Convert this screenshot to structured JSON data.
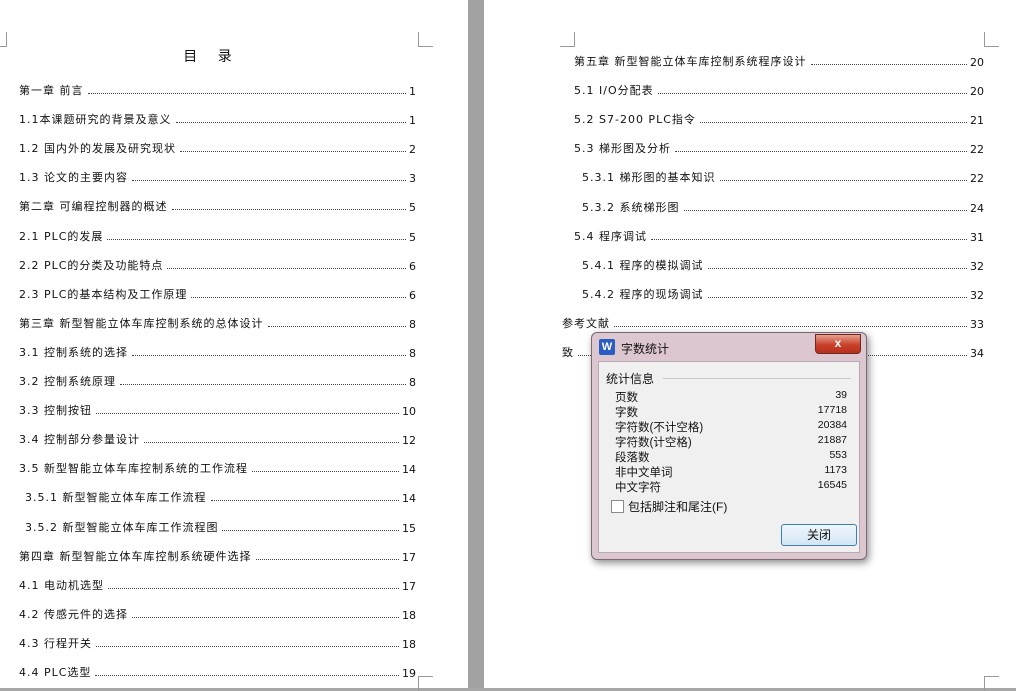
{
  "left_page": {
    "title": "目 录",
    "entries": [
      {
        "text": "第一章 前言",
        "page": "1"
      },
      {
        "text": "1.1本课题研究的背景及意义",
        "page": "1"
      },
      {
        "text": "1.2 国内外的发展及研究现状",
        "page": "2"
      },
      {
        "text": "1.3 论文的主要内容",
        "page": "3"
      },
      {
        "text": "第二章 可编程控制器的概述",
        "page": "5"
      },
      {
        "text": "2.1 PLC的发展",
        "page": "5"
      },
      {
        "text": "2.2 PLC的分类及功能特点",
        "page": "6"
      },
      {
        "text": "2.3 PLC的基本结构及工作原理",
        "page": "6"
      },
      {
        "text": "第三章 新型智能立体车库控制系统的总体设计",
        "page": "8"
      },
      {
        "text": "3.1 控制系统的选择",
        "page": "8"
      },
      {
        "text": "3.2 控制系统原理",
        "page": "8"
      },
      {
        "text": "3.3 控制按钮",
        "page": "10"
      },
      {
        "text": "3.4 控制部分参量设计",
        "page": "12"
      },
      {
        "text": "3.5 新型智能立体车库控制系统的工作流程",
        "page": "14"
      },
      {
        "text": "3.5.1 新型智能立体车库工作流程",
        "page": "14"
      },
      {
        "text": "3.5.2 新型智能立体车库工作流程图",
        "page": "15"
      },
      {
        "text": "第四章 新型智能立体车库控制系统硬件选择",
        "page": "17"
      },
      {
        "text": "4.1 电动机选型",
        "page": "17"
      },
      {
        "text": "4.2 传感元件的选择",
        "page": "18"
      },
      {
        "text": "4.3 行程开关",
        "page": "18"
      },
      {
        "text": "4.4 PLC选型",
        "page": "19"
      }
    ]
  },
  "right_page": {
    "entries": [
      {
        "text": "第五章 新型智能立体车库控制系统程序设计",
        "page": "20"
      },
      {
        "text": "5.1 I/O分配表",
        "page": "20"
      },
      {
        "text": "5.2 S7-200 PLC指令",
        "page": "21"
      },
      {
        "text": "5.3 梯形图及分析",
        "page": "22"
      },
      {
        "text": "5.3.1 梯形图的基本知识",
        "page": "22"
      },
      {
        "text": "5.3.2 系统梯形图",
        "page": "24"
      },
      {
        "text": "5.4 程序调试",
        "page": "31"
      },
      {
        "text": "5.4.1 程序的模拟调试",
        "page": "32"
      },
      {
        "text": "5.4.2 程序的现场调试",
        "page": "32"
      },
      {
        "text": "参考文献",
        "page": "33"
      },
      {
        "text": "致",
        "page": "34"
      }
    ]
  },
  "dialog": {
    "logo": "W",
    "title": "字数统计",
    "close_x": "x",
    "group_label": "统计信息",
    "stats": [
      {
        "label": "页数",
        "value": "39"
      },
      {
        "label": "字数",
        "value": "17718"
      },
      {
        "label": "字符数(不计空格)",
        "value": "20384"
      },
      {
        "label": "字符数(计空格)",
        "value": "21887"
      },
      {
        "label": "段落数",
        "value": "553"
      },
      {
        "label": "非中文单词",
        "value": "1173"
      },
      {
        "label": "中文字符",
        "value": "16545"
      }
    ],
    "footnote_label": "包括脚注和尾注(F)",
    "close_button": "关闭"
  },
  "colors": {
    "background": "#a7a7a7",
    "dialog_frame": "#dcc6cf",
    "close_x": "#c8402a",
    "button_border": "#3c7fb1"
  }
}
